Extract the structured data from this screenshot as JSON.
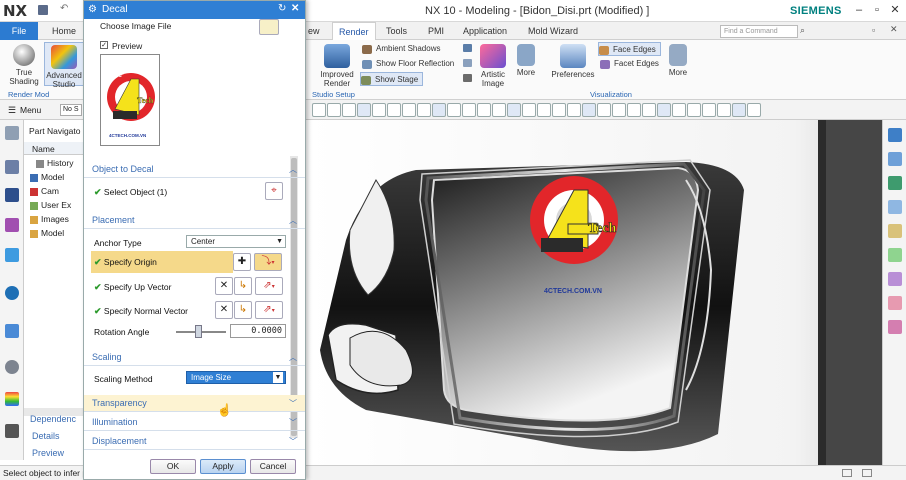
{
  "app": {
    "logo": "NX",
    "title": "NX 10 - Modeling - [Bidon_Disi.prt (Modified) ]",
    "brand": "SIEMENS"
  },
  "ribbon": {
    "file_tab": "File",
    "tabs": [
      "Home",
      "ew",
      "Render",
      "Tools",
      "PMI",
      "Application",
      "Mold Wizard"
    ],
    "active_tab": "Render",
    "search_placeholder": "Find a Command",
    "true_shading": "True\nShading",
    "advanced_studio": "Advanced\nStudio",
    "render_mode_group": "Render Mod",
    "improved_render": "Improved\nRender",
    "studio_setup_group": "Studio Setup",
    "ambient_shadows": "Ambient Shadows",
    "show_floor_reflection": "Show Floor Reflection",
    "show_stage": "Show Stage",
    "artistic_image": "Artistic\nImage",
    "more1": "More",
    "preferences": "Preferences",
    "face_edges": "Face Edges",
    "facet_edges": "Facet Edges",
    "more2": "More",
    "visualization_group": "Visualization"
  },
  "menu": {
    "label": "Menu",
    "filter": "No S"
  },
  "navigator": {
    "title": "Part Navigato",
    "column": "Name",
    "items": [
      "History",
      "Model",
      "Cam",
      "User Ex",
      "Images",
      "Model"
    ],
    "bottom_panels": [
      "Dependenc",
      "Details",
      "Preview"
    ]
  },
  "dialog": {
    "title": "Decal",
    "choose_image": "Choose Image File",
    "preview_label": "Preview",
    "preview_checked": true,
    "logo_text_top": "CNC",
    "logo_text_mid": "Tech",
    "logo_text_url": "4CTECH.COM.VN",
    "sections": {
      "object_to_decal": "Object to Decal",
      "placement": "Placement",
      "scaling": "Scaling",
      "transparency": "Transparency",
      "illumination": "Illumination",
      "displacement": "Displacement"
    },
    "select_object": "Select Object (1)",
    "anchor_type_label": "Anchor Type",
    "anchor_type_value": "Center",
    "specify_origin": "Specify Origin",
    "specify_up_vector": "Specify Up Vector",
    "specify_normal_vector": "Specify Normal Vector",
    "rotation_angle_label": "Rotation Angle",
    "rotation_angle_value": "0.0000",
    "scaling_method_label": "Scaling Method",
    "scaling_method_value": "Image Size",
    "ok": "OK",
    "apply": "Apply",
    "cancel": "Cancel"
  },
  "viewport": {
    "decal_url": "4CTECH.COM.VN",
    "decal_tech": "Tech"
  },
  "status": {
    "text": "Select object to infer p"
  },
  "colors": {
    "accent": "#2f7fd4",
    "ribbon_file": "#2c7bd1",
    "highlight": "#f5d98a",
    "brand": "#00807f",
    "check_green": "#2c9a2c"
  }
}
